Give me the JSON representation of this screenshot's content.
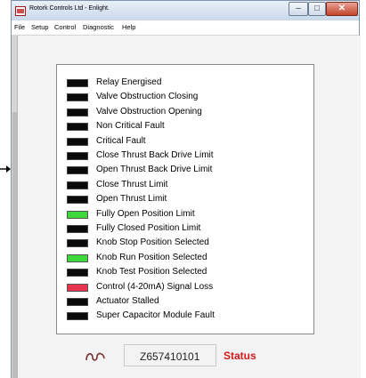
{
  "window": {
    "title": "Rotork Controls Ltd - Enlight.",
    "minimize_glyph": "–",
    "maximize_glyph": "□",
    "close_glyph": "✕"
  },
  "menu": {
    "items": [
      "File",
      "Setup",
      "Control",
      "Diagnostic",
      "Help"
    ]
  },
  "colors": {
    "led_off": "#0a0a0a",
    "led_green": "#3fd83a",
    "led_red": "#e8344e",
    "status_red": "#d81a1a"
  },
  "status_panel": {
    "items": [
      {
        "label": "Relay Energised",
        "state": "off"
      },
      {
        "label": "Valve Obstruction Closing",
        "state": "off"
      },
      {
        "label": "Valve Obstruction Opening",
        "state": "off"
      },
      {
        "label": "Non Critical Fault",
        "state": "off"
      },
      {
        "label": "Critical Fault",
        "state": "off"
      },
      {
        "label": "Close Thrust Back Drive Limit",
        "state": "off"
      },
      {
        "label": "Open Thrust Back Drive Limit",
        "state": "off"
      },
      {
        "label": "Close Thrust Limit",
        "state": "off"
      },
      {
        "label": "Open Thrust Limit",
        "state": "off"
      },
      {
        "label": "Fully Open Position Limit",
        "state": "green"
      },
      {
        "label": "Fully Closed Position Limit",
        "state": "off"
      },
      {
        "label": "Knob Stop Position Selected",
        "state": "off"
      },
      {
        "label": "Knob Run Position Selected",
        "state": "green"
      },
      {
        "label": "Knob Test Position Selected",
        "state": "off"
      },
      {
        "label": "Control (4-20mA) Signal Loss",
        "state": "red"
      },
      {
        "label": "Actuator Stalled",
        "state": "off"
      },
      {
        "label": "Super Capacitor Module Fault",
        "state": "off"
      }
    ]
  },
  "footer": {
    "serial_number": "Z657410101",
    "status_label": "Status"
  }
}
